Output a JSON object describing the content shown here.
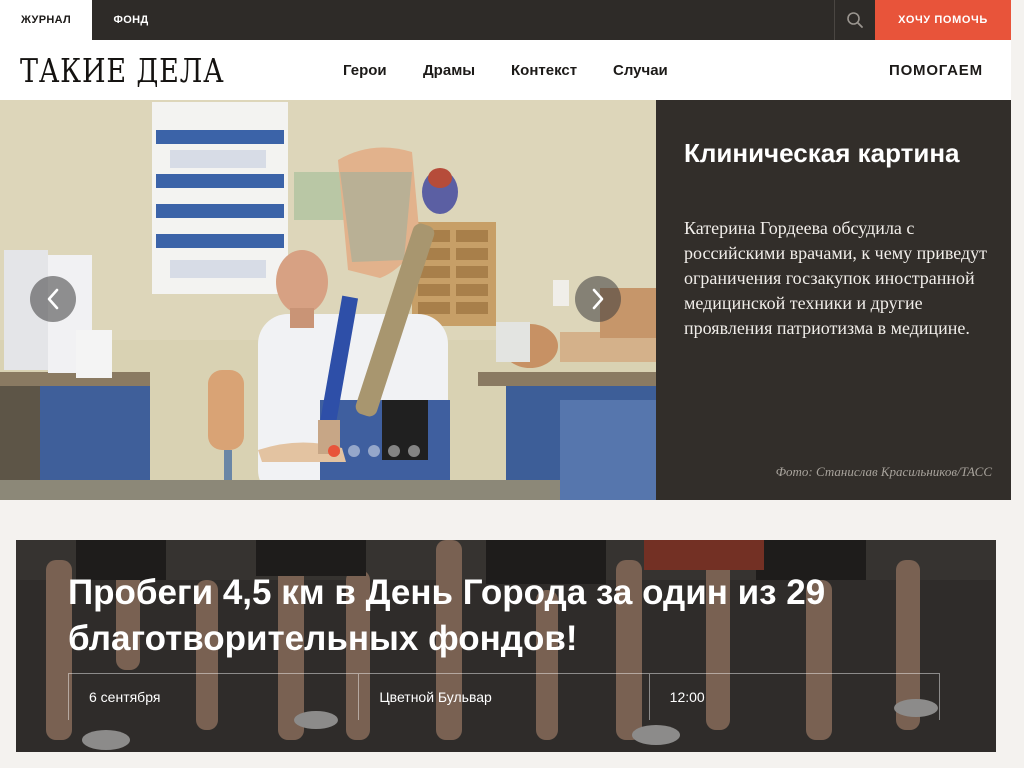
{
  "topbar": {
    "tabs": [
      {
        "label": "ЖУРНАЛ",
        "active": true
      },
      {
        "label": "ФОНД",
        "active": false
      }
    ],
    "search_icon": "search-icon",
    "help_button": "ХОЧУ ПОМОЧЬ",
    "colors": {
      "bar": "#2e2b28",
      "accent": "#e8543a"
    }
  },
  "navbar": {
    "logo": "ТАКИЕ ДЕЛА",
    "items": [
      "Герои",
      "Драмы",
      "Контекст",
      "Случаи"
    ],
    "help_link": "ПОМОГАЕМ"
  },
  "hero": {
    "title": "Клиническая картина",
    "text": "Катерина Гордеева обсудила с российскими врачами, к чему приведут ограничения госзакупок иностранной медицинской техники и другие проявления патриотизма в медицине.",
    "credit": "Фото: Станислав Красильников/ТАСС",
    "slide_count": 5,
    "active_slide": 1,
    "icons": {
      "prev": "chevron-left-icon",
      "next": "chevron-right-icon"
    }
  },
  "banner": {
    "title": "Пробеги 4,5 км в День Города за один из 29 благотворительных фондов!",
    "date": "6 сентября",
    "place": "Цветной Бульвар",
    "time": "12:00"
  }
}
